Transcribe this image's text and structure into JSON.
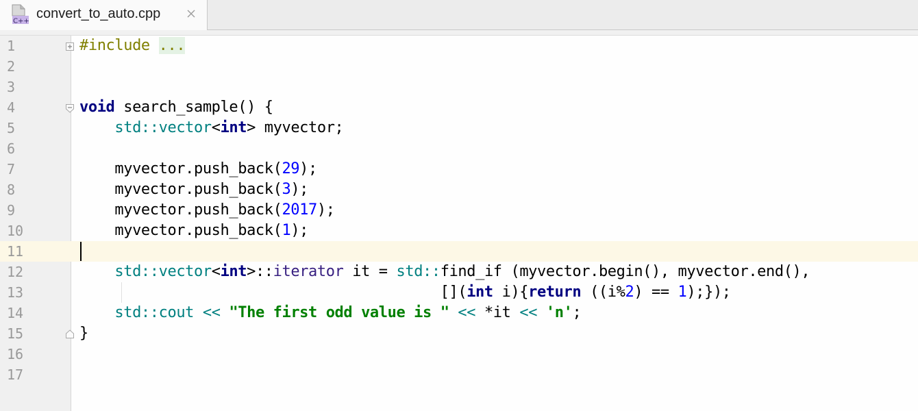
{
  "tab": {
    "file_name": "convert_to_auto.cpp",
    "file_type_label": "C++",
    "file_icon": "cpp-file-icon",
    "close_icon": "close-icon"
  },
  "editor": {
    "current_line": 11,
    "lines": [
      {
        "number": "1"
      },
      {
        "number": "2"
      },
      {
        "number": "3"
      },
      {
        "number": "4"
      },
      {
        "number": "5"
      },
      {
        "number": "6"
      },
      {
        "number": "7"
      },
      {
        "number": "8"
      },
      {
        "number": "9"
      },
      {
        "number": "10"
      },
      {
        "number": "11"
      },
      {
        "number": "12"
      },
      {
        "number": "13"
      },
      {
        "number": "14"
      },
      {
        "number": "15"
      },
      {
        "number": "16"
      },
      {
        "number": "17"
      }
    ],
    "tokens": {
      "l1": {
        "directive": "#include",
        "space": " ",
        "folded": "..."
      },
      "l4": {
        "kw_void": "void",
        "rest": " search_sample() {"
      },
      "l5": {
        "indent": "    ",
        "ns": "std::",
        "type": "vector",
        "lt": "<",
        "kw": "int",
        "rest": "> myvector;"
      },
      "l7": {
        "indent": "    ",
        "call": "myvector.push_back(",
        "num": "29",
        "end": ");"
      },
      "l8": {
        "indent": "    ",
        "call": "myvector.push_back(",
        "num": "3",
        "end": ");"
      },
      "l9": {
        "indent": "    ",
        "call": "myvector.push_back(",
        "num": "2017",
        "end": ");"
      },
      "l10": {
        "indent": "    ",
        "call": "myvector.push_back(",
        "num": "1",
        "end": ");"
      },
      "l12": {
        "indent": "    ",
        "ns1": "std::",
        "type1": "vector",
        "lt": "<",
        "kw": "int",
        "gt": ">::",
        "iter": "iterator",
        "mid": " it = ",
        "ns2": "std::",
        "rest": "find_if (myvector.begin(), myvector.end(),"
      },
      "l13": {
        "indent": "                                         ",
        "a": "[](",
        "kw_int": "int",
        "b": " i){",
        "kw_ret": "return",
        "c": " ((i%",
        "n2": "2",
        "d": ") == ",
        "n1": "1",
        "e": ");});"
      },
      "l14": {
        "indent": "    ",
        "ns": "std::",
        "cout": "cout",
        "op1": " << ",
        "str": "\"The first odd value is \"",
        "op2": " << ",
        "deref": "*",
        "it": "it",
        "op3": " << ",
        "chr": "'n'",
        "end": ";"
      },
      "l15": {
        "brace": "}"
      }
    }
  },
  "colors": {
    "keyword": "#000080",
    "namespace": "#008080",
    "number": "#0000ff",
    "string": "#008000",
    "preprocessor": "#808000",
    "current_line_bg": "#fdf8e6"
  }
}
